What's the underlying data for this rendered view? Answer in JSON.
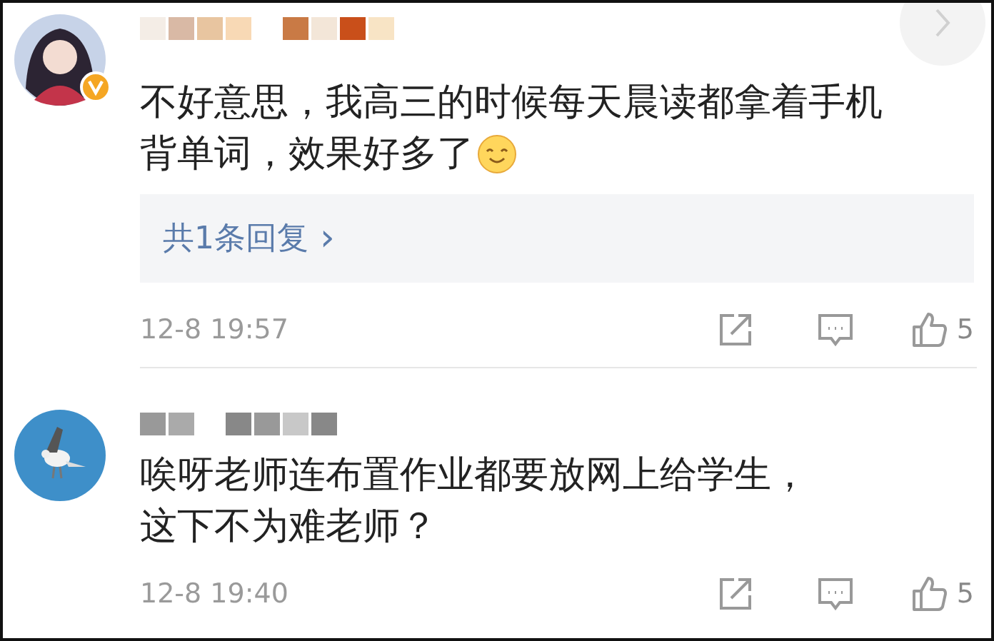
{
  "comments": [
    {
      "avatar": {
        "kind": "character",
        "verified": true
      },
      "name_hidden": true,
      "text_lines": [
        "不好意思，我高三的时候每天晨读都拿着手机",
        "背单词，效果好多了"
      ],
      "emoji": true,
      "replies_link": "共1条回复",
      "replies_chevron": "›",
      "time": "12-8 19:57",
      "likes": "5"
    },
    {
      "name_hidden": true,
      "text_lines": [
        "唉呀老师连布置作业都要放网上给学生，",
        "这下不为难老师？"
      ],
      "emoji": false,
      "time": "12-8 19:40",
      "likes": "5"
    }
  ]
}
